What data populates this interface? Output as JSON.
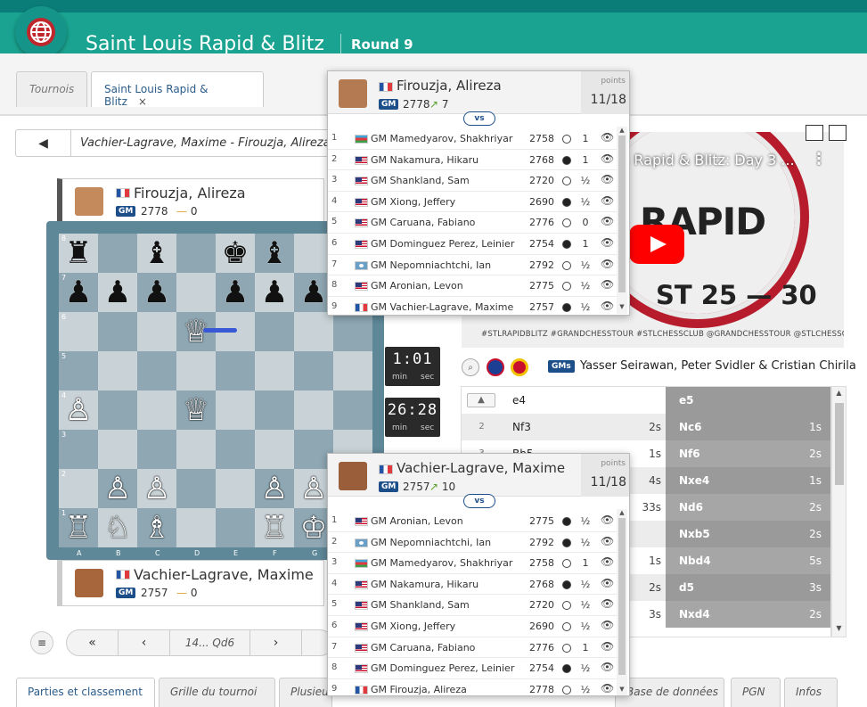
{
  "header": {
    "title": "Saint Louis Rapid & Blitz",
    "round": "Round 9",
    "logo_icon": "globe-icon"
  },
  "tabs": [
    {
      "label": "Tournois"
    },
    {
      "label": "Saint Louis Rapid & Blitz",
      "close": "×"
    }
  ],
  "game_bar": {
    "back_icon": "◀",
    "title": "Vachier-Lagrave, Maxime - Firouzja, Alireza"
  },
  "board_top_player": {
    "name": "Firouzja, Alireza",
    "title": "GM",
    "elo": "2778",
    "delta_sign": "—",
    "delta": "0"
  },
  "board_bottom_player": {
    "name": "Vachier-Lagrave, Maxime",
    "title": "GM",
    "elo": "2757",
    "delta_sign": "—",
    "delta": "0"
  },
  "board": {
    "ranks": [
      "8",
      "7",
      "6",
      "5",
      "4",
      "3",
      "2",
      "1"
    ],
    "files": [
      "A",
      "B",
      "C",
      "D",
      "E",
      "F",
      "G",
      "H"
    ],
    "pieces": [
      [
        "♜",
        "",
        "♝",
        "",
        "♚",
        "♝",
        "",
        ""
      ],
      [
        "♟",
        "♟",
        "♟",
        "",
        "♟",
        "♟",
        "♟",
        ""
      ],
      [
        "",
        "",
        "",
        "♕",
        "",
        "",
        "",
        ""
      ],
      [
        "",
        "",
        "",
        "",
        "",
        "",
        "",
        ""
      ],
      [
        "♙",
        "",
        "",
        "♕",
        "",
        "",
        "",
        ""
      ],
      [
        "",
        "",
        "",
        "",
        "",
        "",
        "",
        ""
      ],
      [
        "",
        "♙",
        "♙",
        "",
        "",
        "♙",
        "♙",
        ""
      ],
      [
        "♖",
        "♘",
        "♗",
        "",
        "",
        "♖",
        "♔",
        ""
      ]
    ],
    "piece_colors": [
      [
        "b",
        "",
        "b",
        "",
        "b",
        "b",
        "",
        ""
      ],
      [
        "b",
        "b",
        "b",
        "",
        "b",
        "b",
        "b",
        ""
      ],
      [
        "",
        "",
        "",
        "w",
        "",
        "",
        "",
        ""
      ],
      [
        "",
        "",
        "",
        "",
        "",
        "",
        "",
        ""
      ],
      [
        "w",
        "",
        "",
        "w",
        "",
        "",
        "",
        ""
      ],
      [
        "",
        "",
        "",
        "",
        "",
        "",
        "",
        ""
      ],
      [
        "",
        "w",
        "w",
        "",
        "",
        "w",
        "w",
        ""
      ],
      [
        "w",
        "w",
        "w",
        "",
        "",
        "w",
        "w",
        ""
      ]
    ]
  },
  "clocks": [
    {
      "time": "1:01",
      "min": "min",
      "sec": "sec"
    },
    {
      "time": "26:28",
      "min": "min",
      "sec": "sec"
    }
  ],
  "nav": {
    "menu_icon": "≡",
    "first": "«",
    "prev": "‹",
    "move": "14... Qd6",
    "next": "›"
  },
  "bottom_tabs": [
    {
      "label": "Parties et classement"
    },
    {
      "label": "Grille du tournoi"
    },
    {
      "label": "Plusieurs"
    },
    {
      "label": "Base de données"
    },
    {
      "label": "PGN"
    },
    {
      "label": "Infos"
    }
  ],
  "video": {
    "title": "s Rapid & Blitz: Day 3 ...",
    "menu": "⋮",
    "logo_text": "RAPID",
    "dates": "ST 25 — 30",
    "tags": "#STLRAPIDBLITZ #GRANDCHESSTOUR #STLCHESSCLUB @GRANDCHESSTOUR @STLCHESSCLUB"
  },
  "commentary": {
    "badge": "GMs",
    "names": "Yasser Seirawan, Peter Svidler & Cristian Chirila"
  },
  "moves": [
    {
      "n": "",
      "w": "e4",
      "wt": "",
      "b": "e5",
      "bt": ""
    },
    {
      "n": "2",
      "w": "Nf3",
      "wt": "2s",
      "b": "Nc6",
      "bt": "1s"
    },
    {
      "n": "3",
      "w": "Bb5",
      "wt": "1s",
      "b": "Nf6",
      "bt": "2s"
    },
    {
      "n": "",
      "w": "",
      "wt": "4s",
      "b": "Nxe4",
      "bt": "1s"
    },
    {
      "n": "",
      "w": "",
      "wt": "33s",
      "b": "Nd6",
      "bt": "2s"
    },
    {
      "n": "",
      "w": "",
      "wt": "",
      "b": "Nxb5",
      "bt": "2s"
    },
    {
      "n": "",
      "w": "",
      "wt": "1s",
      "b": "Nbd4",
      "bt": "5s"
    },
    {
      "n": "",
      "w": "",
      "wt": "2s",
      "b": "d5",
      "bt": "3s"
    },
    {
      "n": "",
      "w": "",
      "wt": "3s",
      "b": "Nxd4",
      "bt": "2s"
    }
  ],
  "popup_firouzja": {
    "name": "Firouzja, Alireza",
    "title": "GM",
    "elo": "2778",
    "delta_icon": "↗",
    "delta": "7",
    "points_label": "points",
    "points": "11/18",
    "vs": "vs",
    "rows": [
      {
        "i": "1",
        "flag": "az",
        "name": "GM Mamedyarov, Shakhriyar",
        "elo": "2758",
        "color": "white",
        "score": "1"
      },
      {
        "i": "2",
        "flag": "us",
        "name": "GM Nakamura, Hikaru",
        "elo": "2768",
        "color": "black",
        "score": "1"
      },
      {
        "i": "3",
        "flag": "us",
        "name": "GM Shankland, Sam",
        "elo": "2720",
        "color": "white",
        "score": "½"
      },
      {
        "i": "4",
        "flag": "us",
        "name": "GM Xiong, Jeffery",
        "elo": "2690",
        "color": "black",
        "score": "½"
      },
      {
        "i": "5",
        "flag": "us",
        "name": "GM Caruana, Fabiano",
        "elo": "2776",
        "color": "white",
        "score": "0"
      },
      {
        "i": "6",
        "flag": "us",
        "name": "GM Dominguez Perez, Leinier",
        "elo": "2754",
        "color": "black",
        "score": "1"
      },
      {
        "i": "7",
        "flag": "fid",
        "name": "GM Nepomniachtchi, Ian",
        "elo": "2792",
        "color": "white",
        "score": "½"
      },
      {
        "i": "8",
        "flag": "us",
        "name": "GM Aronian, Levon",
        "elo": "2775",
        "color": "white",
        "score": "½"
      },
      {
        "i": "9",
        "flag": "fr",
        "name": "GM Vachier-Lagrave, Maxime",
        "elo": "2757",
        "color": "black",
        "score": "½"
      }
    ]
  },
  "popup_mvl": {
    "name": "Vachier-Lagrave, Maxime",
    "title": "GM",
    "elo": "2757",
    "delta_icon": "↗",
    "delta": "10",
    "points_label": "points",
    "points": "11/18",
    "vs": "vs",
    "rows": [
      {
        "i": "1",
        "flag": "us",
        "name": "GM Aronian, Levon",
        "elo": "2775",
        "color": "black",
        "score": "½"
      },
      {
        "i": "2",
        "flag": "fid",
        "name": "GM Nepomniachtchi, Ian",
        "elo": "2792",
        "color": "black",
        "score": "½"
      },
      {
        "i": "3",
        "flag": "az",
        "name": "GM Mamedyarov, Shakhriyar",
        "elo": "2758",
        "color": "white",
        "score": "1"
      },
      {
        "i": "4",
        "flag": "us",
        "name": "GM Nakamura, Hikaru",
        "elo": "2768",
        "color": "black",
        "score": "½"
      },
      {
        "i": "5",
        "flag": "us",
        "name": "GM Shankland, Sam",
        "elo": "2720",
        "color": "white",
        "score": "½"
      },
      {
        "i": "6",
        "flag": "us",
        "name": "GM Xiong, Jeffery",
        "elo": "2690",
        "color": "white",
        "score": "½"
      },
      {
        "i": "7",
        "flag": "us",
        "name": "GM Caruana, Fabiano",
        "elo": "2776",
        "color": "white",
        "score": "1"
      },
      {
        "i": "8",
        "flag": "us",
        "name": "GM Dominguez Perez, Leinier",
        "elo": "2754",
        "color": "black",
        "score": "½"
      },
      {
        "i": "9",
        "flag": "fr",
        "name": "GM Firouzja, Alireza",
        "elo": "2778",
        "color": "white",
        "score": "½"
      }
    ]
  }
}
